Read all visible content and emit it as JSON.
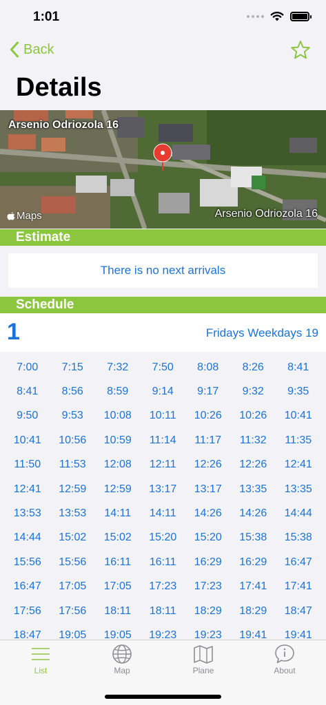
{
  "status_bar": {
    "time": "1:01"
  },
  "nav": {
    "back_label": "Back",
    "title": "Details"
  },
  "map": {
    "label_top": "Arsenio Odriozola 16",
    "label_bottom": "Arsenio Odriozola 16",
    "logo_text": "Maps",
    "pin_color": "#e53b30"
  },
  "estimate": {
    "header": "Estimate",
    "message": "There is no next arrivals"
  },
  "schedule": {
    "header": "Schedule",
    "route_number": "1",
    "route_description": "Fridays Weekdays 19",
    "times": [
      "7:00",
      "7:15",
      "7:32",
      "7:50",
      "8:08",
      "8:26",
      "8:41",
      "8:41",
      "8:56",
      "8:59",
      "9:14",
      "9:17",
      "9:32",
      "9:35",
      "9:50",
      "9:53",
      "10:08",
      "10:11",
      "10:26",
      "10:26",
      "10:41",
      "10:41",
      "10:56",
      "10:59",
      "11:14",
      "11:17",
      "11:32",
      "11:35",
      "11:50",
      "11:53",
      "12:08",
      "12:11",
      "12:26",
      "12:26",
      "12:41",
      "12:41",
      "12:59",
      "12:59",
      "13:17",
      "13:17",
      "13:35",
      "13:35",
      "13:53",
      "13:53",
      "14:11",
      "14:11",
      "14:26",
      "14:26",
      "14:44",
      "14:44",
      "15:02",
      "15:02",
      "15:20",
      "15:20",
      "15:38",
      "15:38",
      "15:56",
      "15:56",
      "16:11",
      "16:11",
      "16:29",
      "16:29",
      "16:47",
      "16:47",
      "17:05",
      "17:05",
      "17:23",
      "17:23",
      "17:41",
      "17:41",
      "17:56",
      "17:56",
      "18:11",
      "18:11",
      "18:29",
      "18:29",
      "18:47",
      "18:47",
      "19:05",
      "19:05",
      "19:23",
      "19:23",
      "19:41",
      "19:41"
    ]
  },
  "tabs": [
    {
      "label": "List",
      "icon": "list-icon",
      "active": true
    },
    {
      "label": "Map",
      "icon": "globe-icon",
      "active": false
    },
    {
      "label": "Plane",
      "icon": "folded-map-icon",
      "active": false
    },
    {
      "label": "About",
      "icon": "info-bubble-icon",
      "active": false
    }
  ],
  "colors": {
    "accent": "#8cc63f",
    "link": "#1a73d9",
    "inactive_tab": "#8e8e93"
  }
}
